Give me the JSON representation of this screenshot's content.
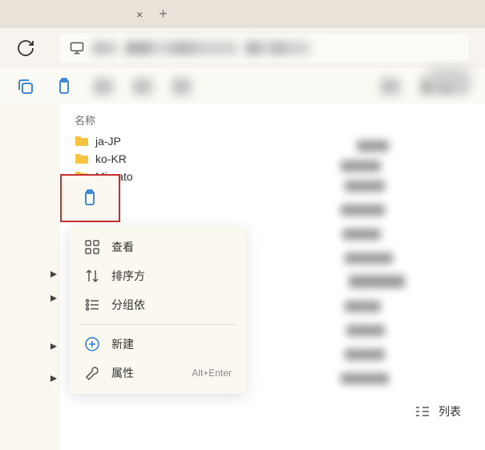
{
  "tabs": {
    "close_label": "×",
    "new_label": "+"
  },
  "file_list": {
    "header": "名称",
    "items": [
      {
        "name": "ja-JP",
        "type": "folder"
      },
      {
        "name": "ko-KR",
        "type": "folder"
      },
      {
        "name": "Migrato",
        "type": "folder"
      }
    ]
  },
  "context_menu": {
    "view": "查看",
    "sort": "排序方",
    "group": "分组依",
    "new": "新建",
    "properties": "属性",
    "properties_shortcut": "Alt+Enter"
  },
  "view_mode": {
    "label": "列表"
  }
}
